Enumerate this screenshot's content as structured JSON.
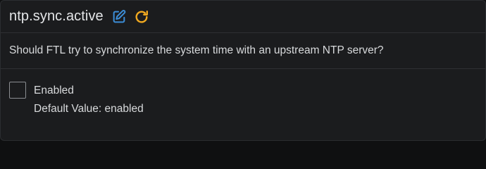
{
  "setting": {
    "name": "ntp.sync.active",
    "edit_icon": "edit-icon",
    "reset_icon": "reset-icon",
    "edit_icon_color": "#3c8dd6",
    "reset_icon_color": "#f0a920",
    "description": "Should FTL try to synchronize the system time with an upstream NTP server?",
    "checkbox": {
      "label": "Enabled",
      "checked": false
    },
    "default_value_text": "Default Value: enabled"
  }
}
